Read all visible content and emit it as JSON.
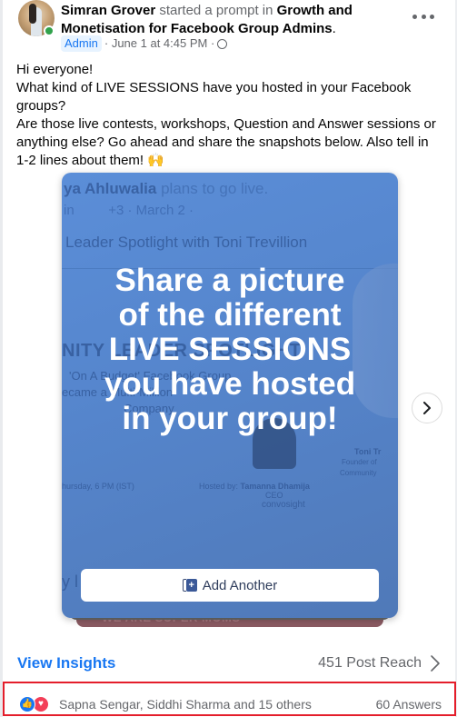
{
  "post": {
    "author": "Simran Grover",
    "action": "started a prompt in",
    "group": "Growth and Monetisation for Facebook Group Admins",
    "role_badge": "Admin",
    "timestamp": "June 1 at 4:45 PM",
    "separator": "·",
    "privacy_icon": "globe-icon",
    "more_icon": "more-options-icon",
    "body": "Hi everyone!\nWhat kind of LIVE SESSIONS have you hosted in your Facebook groups?\nAre those live contests, workshops, Question and Answer sessions or anything else? Go ahead and share the snapshots below. Also tell in 1-2 lines about them! 🙌"
  },
  "prompt_card": {
    "title_lines": [
      "Share a picture",
      "of the different",
      "LIVE SESSIONS",
      "you have hosted",
      "in your group!"
    ],
    "add_button_label": "Add Another",
    "background_snapshot": {
      "author_fragment": "ya Ahluwalia",
      "action": "plans to go live.",
      "meta_fragment": "in",
      "meta_count": "+3",
      "meta_date": "· March 2 ·",
      "event_title": "Leader Spotlight with Toni Trevillion",
      "banner_heading": "NITY LEADER SPOTLIGHT",
      "banner_line1": "'On A Budget' Facebook Group",
      "banner_line2": "ecame a Multi-Million",
      "banner_line3": "Company",
      "schedule": "hursday, 6 PM (IST)",
      "hosted_by_label": "Hosted by:",
      "host_name": "Tamanna Dhamija",
      "host_title": "CEO",
      "host_company": "convosight",
      "guest_name": "Toni Tr",
      "guest_role1": "Founder of",
      "guest_role2": "Community",
      "footer_fragment": "y l",
      "next_card_text": "WE ARE SUPER MOMS"
    }
  },
  "carousel": {
    "next_icon": "chevron-right-icon"
  },
  "insights": {
    "link_label": "View Insights",
    "reach_label": "451 Post Reach"
  },
  "reactions": {
    "icons": [
      "like-icon",
      "love-icon"
    ],
    "summary": "Sapna Sengar, Siddhi Sharma and 15 others",
    "answers": "60 Answers"
  },
  "colors": {
    "link_blue": "#1877f2",
    "muted": "#65676b",
    "card_blue": "#5585cc",
    "highlight_red": "#e41e2b",
    "online_green": "#31a24c"
  }
}
